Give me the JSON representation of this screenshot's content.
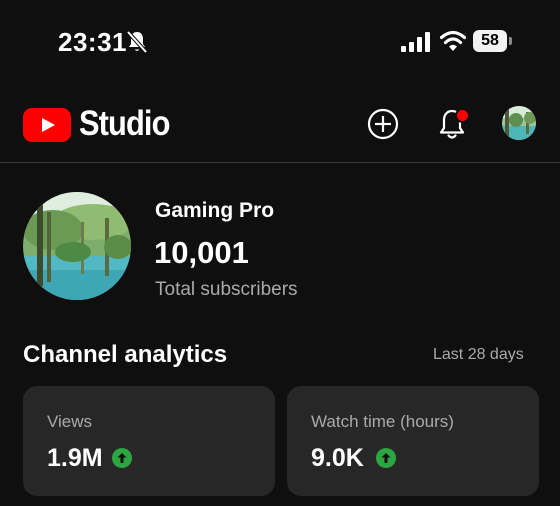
{
  "status_bar": {
    "time": "23:31",
    "battery_level": "58",
    "icons": [
      "bell-slash-icon",
      "signal-icon",
      "wifi-icon",
      "battery-icon"
    ]
  },
  "header": {
    "app_name": "Studio",
    "logo": "youtube-play-logo",
    "actions": [
      "create-plus-icon",
      "notification-bell-icon",
      "account-avatar"
    ],
    "notification_dot_color": "#ff0000"
  },
  "channel": {
    "name": "Gaming Pro",
    "subscriber_count": "10,001",
    "subscriber_label": "Total subscribers"
  },
  "analytics": {
    "title": "Channel analytics",
    "period": "Last 28 days",
    "cards": [
      {
        "label": "Views",
        "value": "1.9M",
        "trend_icon": "arrow-up-icon"
      },
      {
        "label": "Watch time (hours)",
        "value": "9.0K",
        "trend_icon": "arrow-up-icon"
      }
    ]
  },
  "colors": {
    "background": "#0f0f0f",
    "card": "#272727",
    "brand_red": "#ff0000",
    "trend_green": "#2ba640",
    "secondary_text": "#aaaaaa"
  }
}
